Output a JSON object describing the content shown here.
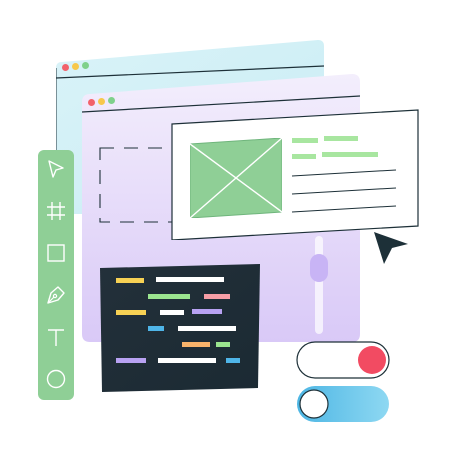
{
  "illustration": {
    "back_window": {
      "dots": [
        "#f2626b",
        "#f7c84b",
        "#7fd18b"
      ],
      "tint": "#cfeef6"
    },
    "front_window": {
      "dots": [
        "#f2626b",
        "#f7c84b",
        "#7fd18b"
      ],
      "tint": "#e7dcfb"
    },
    "toolbar": {
      "color": "#8fcf96",
      "tools": [
        "pointer-icon",
        "frame-icon",
        "rectangle-icon",
        "pen-icon",
        "text-icon",
        "ellipse-icon"
      ]
    },
    "code_panel": {
      "background": "#23303a",
      "tokens": [
        "#f7d154",
        "#ffffff",
        "#9be58f",
        "#f79ea6",
        "#f7d154",
        "#ffffff",
        "#b8a2f2",
        "#4fb5e8",
        "#ffffff",
        "#f9b36b",
        "#9be58f",
        "#b8a2f2",
        "#ffffff",
        "#4fb5e8"
      ]
    },
    "card": {
      "image_color": "#8fcf96",
      "accent": "#a8e6a0"
    },
    "slider": {
      "track": "#e5dcfb",
      "thumb": "#c8b4f5",
      "level": 0.2
    },
    "toggles": [
      {
        "state": "off",
        "knob_color": "#f24b62",
        "track": "#ffffff"
      },
      {
        "state": "on",
        "track": "#5fc3e8"
      }
    ],
    "cursor_color": "#1d3038"
  }
}
